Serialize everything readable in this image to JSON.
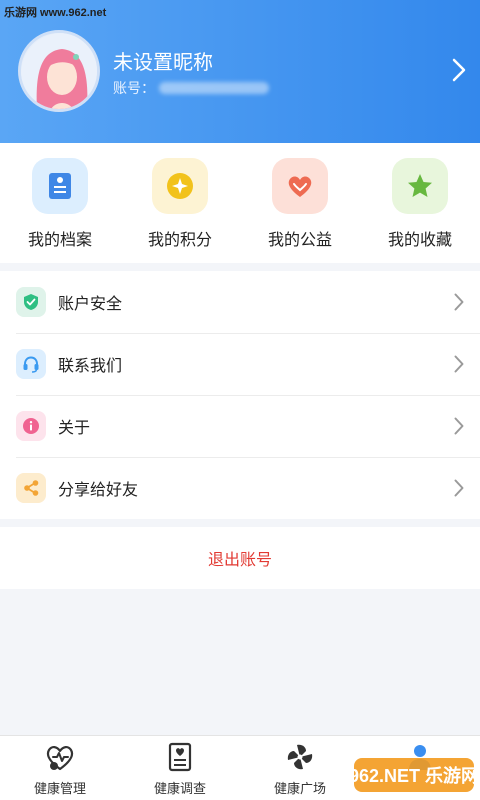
{
  "watermark": "乐游网 www.962.net",
  "profile": {
    "nickname": "未设置昵称",
    "account_label": "账号："
  },
  "quick_actions": [
    {
      "label": "我的档案",
      "icon": "profile-doc-icon",
      "bg": "#dceefe",
      "color": "#3f87e6"
    },
    {
      "label": "我的积分",
      "icon": "points-coin-icon",
      "bg": "#fdf3d3",
      "color": "#f2c21b"
    },
    {
      "label": "我的公益",
      "icon": "charity-heart-icon",
      "bg": "#fde0d8",
      "color": "#ee6b52"
    },
    {
      "label": "我的收藏",
      "icon": "favorite-star-icon",
      "bg": "#e8f6dc",
      "color": "#67b83f"
    }
  ],
  "menu": [
    {
      "label": "账户安全",
      "icon": "shield-icon",
      "bg": "#dff3ea",
      "color": "#2fbf83"
    },
    {
      "label": "联系我们",
      "icon": "headset-icon",
      "bg": "#dceefe",
      "color": "#3a9af0"
    },
    {
      "label": "关于",
      "icon": "info-icon",
      "bg": "#fde3ec",
      "color": "#f06391"
    },
    {
      "label": "分享给好友",
      "icon": "share-icon",
      "bg": "#fdeccd",
      "color": "#f3a536"
    }
  ],
  "logout_label": "退出账号",
  "bottom_nav": [
    {
      "label": "健康管理",
      "icon": "health-heart-icon"
    },
    {
      "label": "健康调查",
      "icon": "survey-clipboard-icon"
    },
    {
      "label": "健康广场",
      "icon": "pinwheel-icon"
    },
    {
      "label": "",
      "icon": "user-icon"
    }
  ],
  "brand_logo_text": "962.NET 乐游网",
  "colors": {
    "header_start": "#5aa6f5",
    "header_end": "#3388ec",
    "logout": "#e23a33"
  }
}
